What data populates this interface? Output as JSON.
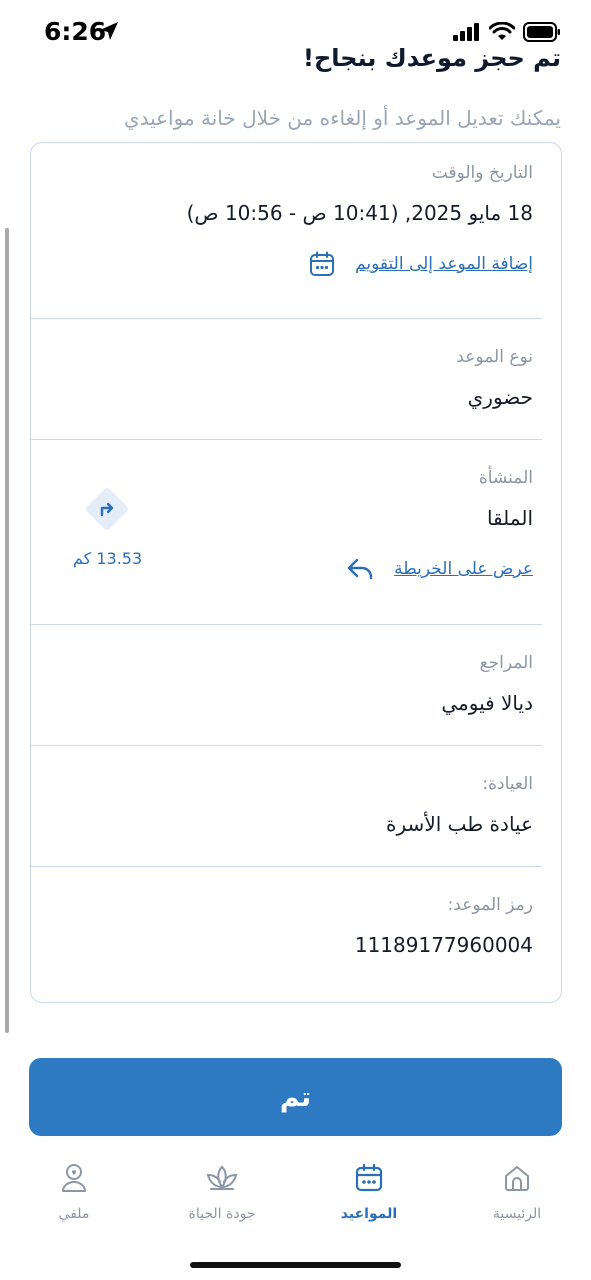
{
  "status_bar": {
    "time": "6:26"
  },
  "header": {
    "title": "تم حجز موعدك بنجاح!",
    "subtitle": "يمكنك تعديل الموعد أو إلغاءه من خلال خانة مواعيدي"
  },
  "details": {
    "datetime": {
      "label": "التاريخ والوقت",
      "value": "18 مايو 2025, (10:41 ص - 10:56 ص)",
      "add_calendar_link": "إضافة الموعد إلى التقويم"
    },
    "type": {
      "label": "نوع الموعد",
      "value": "حضوري"
    },
    "facility": {
      "label": "المنشأة",
      "value": "الملقا",
      "map_link": "عرض على الخريطة",
      "distance": "13.53 كم"
    },
    "patient": {
      "label": "المراجع",
      "value": "ديالا فيومي"
    },
    "clinic": {
      "label": "العيادة:",
      "value": "عيادة طب الأسرة"
    },
    "code": {
      "label": "رمز الموعد:",
      "value": "11189177960004"
    }
  },
  "done_button": "تم",
  "tabs": [
    {
      "label": "الرئيسية",
      "icon": "home-icon",
      "active": false
    },
    {
      "label": "المواعيد",
      "icon": "calendar-icon",
      "active": true
    },
    {
      "label": "جودة الحياة",
      "icon": "lotus-icon",
      "active": false
    },
    {
      "label": "ملفي",
      "icon": "profile-icon",
      "active": false
    }
  ],
  "colors": {
    "primary": "#2d7ac2",
    "link": "#2b6fb8",
    "muted_text": "#8c97a6",
    "card_border": "#c9d8ea"
  }
}
